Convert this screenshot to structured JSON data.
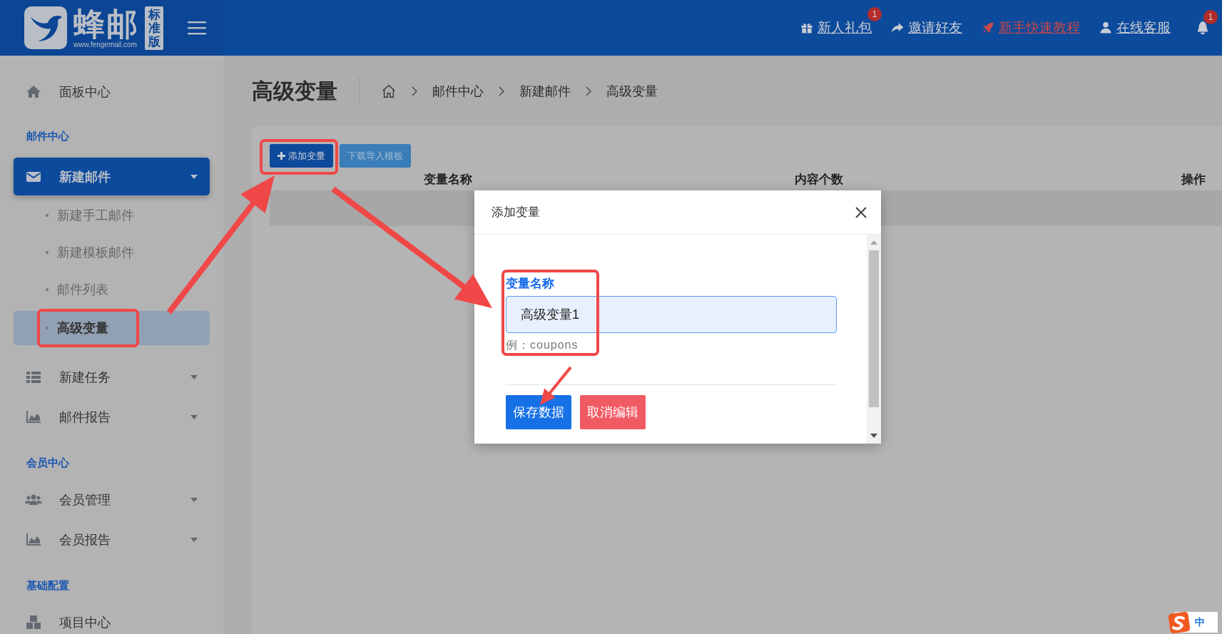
{
  "header": {
    "logo": {
      "name": "蜂邮",
      "edition": "标准版",
      "url": "www.fengemail.com"
    },
    "links": [
      {
        "kind": "gift",
        "label": "新人礼包",
        "badge": "1",
        "highlighted": false
      },
      {
        "kind": "share",
        "label": "邀请好友",
        "highlighted": false
      },
      {
        "kind": "rocket",
        "label": "新手快速教程",
        "highlighted": true
      },
      {
        "kind": "user",
        "label": "在线客服",
        "highlighted": false
      }
    ],
    "notifications": {
      "badge": "1"
    }
  },
  "sidebar": {
    "items": [
      {
        "kind": "home",
        "label": "面板中心",
        "selected": false,
        "dropdown": false
      },
      {
        "kind": "section",
        "label": "邮件中心"
      },
      {
        "kind": "mail",
        "label": "新建邮件",
        "selected": true,
        "dropdown": true,
        "children": [
          {
            "label": "新建手工邮件",
            "selected": false
          },
          {
            "label": "新建模板邮件",
            "selected": false
          },
          {
            "label": "邮件列表",
            "selected": false
          },
          {
            "label": "高级变量",
            "selected": true
          }
        ]
      },
      {
        "kind": "list",
        "label": "新建任务",
        "selected": false,
        "dropdown": true
      },
      {
        "kind": "chart",
        "label": "邮件报告",
        "selected": false,
        "dropdown": true
      },
      {
        "kind": "section",
        "label": "会员中心"
      },
      {
        "kind": "users",
        "label": "会员管理",
        "selected": false,
        "dropdown": true
      },
      {
        "kind": "chart",
        "label": "会员报告",
        "selected": false,
        "dropdown": true
      },
      {
        "kind": "section",
        "label": "基础配置"
      },
      {
        "kind": "boxes",
        "label": "项目中心",
        "selected": false,
        "dropdown": false
      }
    ]
  },
  "page": {
    "title": "高级变量",
    "breadcrumb": [
      "邮件中心",
      "新建邮件",
      "高级变量"
    ],
    "toolbar": [
      {
        "kind": "primary",
        "label": "添加变量",
        "plus": true
      },
      {
        "kind": "info",
        "label": "下载导入模板",
        "plus": false
      }
    ],
    "table": {
      "columns": [
        "变量名称",
        "内容个数",
        "操作"
      ]
    }
  },
  "modal": {
    "title": "添加变量",
    "field": {
      "label": "变量名称",
      "value": "高级变量1",
      "hint": "例：coupons"
    },
    "buttons": [
      {
        "kind": "primary",
        "label": "保存数据"
      },
      {
        "kind": "danger",
        "label": "取消编辑"
      }
    ]
  },
  "ime": {
    "label": "中"
  }
}
